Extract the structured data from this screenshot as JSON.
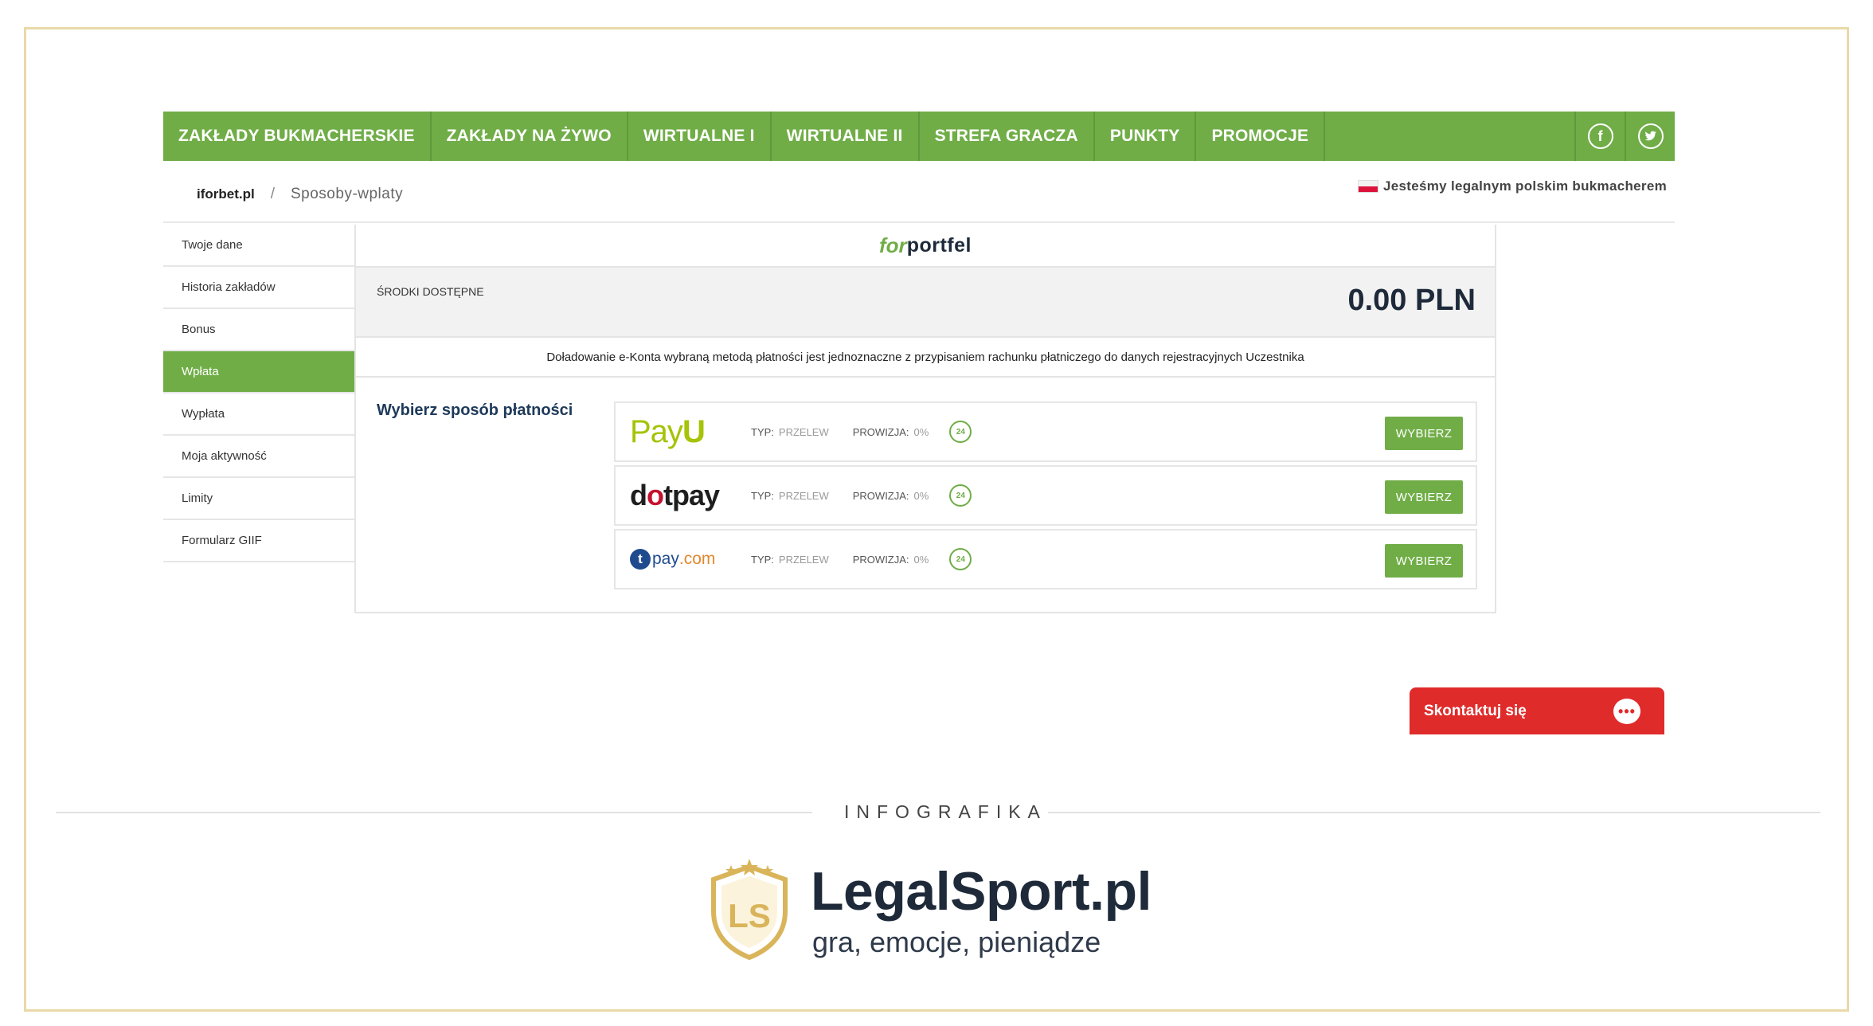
{
  "nav": {
    "items": [
      "ZAKŁADY BUKMACHERSKIE",
      "ZAKŁADY NA ŻYWO",
      "WIRTUALNE I",
      "WIRTUALNE II",
      "STREFA GRACZA",
      "PUNKTY",
      "PROMOCJE"
    ],
    "social": [
      "facebook-icon",
      "twitter-icon"
    ]
  },
  "breadcrumb": {
    "home": "iforbet.pl",
    "separator": "/",
    "current": "Sposoby-wplaty",
    "legal_note": "Jesteśmy legalnym polskim bukmacherem"
  },
  "sidebar": {
    "items": [
      "Twoje dane",
      "Historia zakładów",
      "Bonus",
      "Wpłata",
      "Wypłata",
      "Moja aktywność",
      "Limity",
      "Formularz GIIF"
    ],
    "active_index": 3
  },
  "wallet": {
    "logo_for": "for",
    "logo_portfel": "portfel",
    "balance_label": "ŚRODKI DOSTĘPNE",
    "balance_amount": "0.00 PLN",
    "notice": "Doładowanie e-Konta wybraną metodą płatności jest jednoznaczne z przypisaniem rachunku płatniczego do danych rejestracyjnych Uczestnika"
  },
  "payments": {
    "title": "Wybierz sposób płatności",
    "type_label": "TYP:",
    "fee_label": "PROWIZJA:",
    "button_label": "WYBIERZ",
    "h24_label": "24",
    "methods": [
      {
        "name": "PayU",
        "logo_a": "Pay",
        "logo_b": "U",
        "type": "PRZELEW",
        "fee": "0%"
      },
      {
        "name": "dotpay",
        "logo_a": "d",
        "logo_dot": "o",
        "logo_b": "tpay",
        "type": "PRZELEW",
        "fee": "0%"
      },
      {
        "name": "tpay.com",
        "logo_a": "t",
        "logo_b": "pay",
        "logo_c": ".com",
        "type": "PRZELEW",
        "fee": "0%"
      }
    ]
  },
  "contact": {
    "label": "Skontaktuj się",
    "bubble": "•••"
  },
  "footer": {
    "infographic_label": "INFOGRAFIKA",
    "brand_name": "LegalSport.pl",
    "brand_tagline": "gra, emocje, pieniądze",
    "shield_letters": "LS"
  },
  "colors": {
    "accent_green": "#70ad47",
    "contact_red": "#e02b2b",
    "navy": "#1e2a3a",
    "gold": "#d9b45a"
  }
}
